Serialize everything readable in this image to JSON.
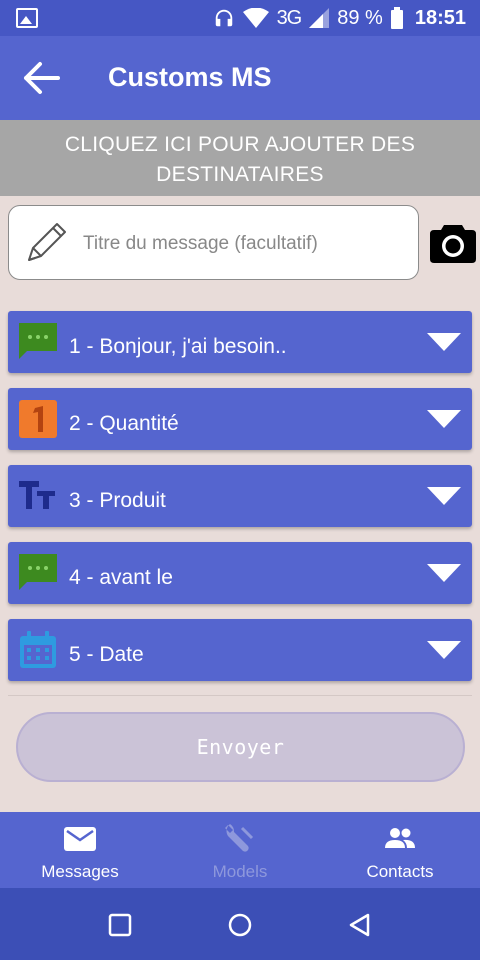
{
  "status_bar": {
    "network": "3G",
    "battery": "89 %",
    "time": "18:51",
    "icons": [
      "image-icon",
      "headphones-icon",
      "wifi-icon",
      "signal-icon",
      "battery-icon"
    ]
  },
  "app_bar": {
    "title": "Customs MS",
    "back_icon": "arrow-left-icon"
  },
  "recipients": {
    "label": "CLIQUEZ ICI POUR AJOUTER DES DESTINATAIRES"
  },
  "message_title": {
    "placeholder": "Titre du message (facultatif)",
    "value": "",
    "icon": "pencil-icon"
  },
  "camera": {
    "icon": "camera-icon"
  },
  "fields": [
    {
      "label": "1 - Bonjour, j'ai besoin..",
      "icon": "chat-bubble-icon",
      "icon_color": "#3d8a1f"
    },
    {
      "label": "2 - Quantité",
      "icon": "number-one-icon",
      "icon_color": "#f07a2c"
    },
    {
      "label": "3 - Produit",
      "icon": "text-format-icon",
      "icon_color": "#1e2b8c"
    },
    {
      "label": "4 - avant le",
      "icon": "chat-bubble-icon",
      "icon_color": "#3d8a1f"
    },
    {
      "label": "5 - Date",
      "icon": "calendar-icon",
      "icon_color": "#2e9be0"
    }
  ],
  "send_button": {
    "label": "Envoyer"
  },
  "bottom_nav": {
    "tabs": [
      {
        "label": "Messages",
        "icon": "mail-icon",
        "active": false
      },
      {
        "label": "Models",
        "icon": "wrench-icon",
        "active": true
      },
      {
        "label": "Contacts",
        "icon": "people-icon",
        "active": false
      }
    ]
  },
  "colors": {
    "primary": "#5565cf",
    "status_bar": "#4657c4",
    "system_nav": "#3c4fb6",
    "background": "#e8dcd9",
    "recipients_bar": "#a6a6a6",
    "active_tab": "#8e98dc",
    "send_button": "#cbc3d7"
  }
}
